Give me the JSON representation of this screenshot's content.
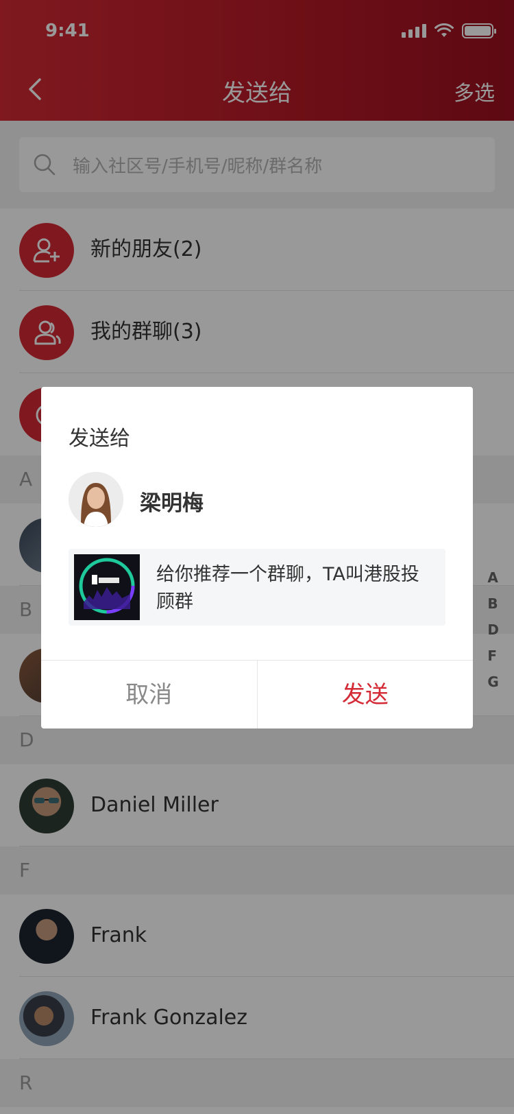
{
  "status": {
    "time": "9:41"
  },
  "header": {
    "title": "发送给",
    "multi_select": "多选"
  },
  "search": {
    "placeholder": "输入社区号/手机号/昵称/群名称"
  },
  "shortcuts": [
    {
      "label": "新的朋友(2)",
      "icon": "add-user-icon"
    },
    {
      "label": "我的群聊(3)",
      "icon": "group-icon"
    }
  ],
  "sections": {
    "a": "A",
    "b": "B",
    "d": "D",
    "f": "F",
    "r": "R"
  },
  "contacts": {
    "daniel": "Daniel Miller",
    "frank": "Frank",
    "frank_g": "Frank Gonzalez"
  },
  "index": [
    "A",
    "B",
    "D",
    "F",
    "G"
  ],
  "dialog": {
    "title": "发送给",
    "recipient": "梁明梅",
    "message": "给你推荐一个群聊，TA叫港股投顾群",
    "cancel": "取消",
    "send": "发送"
  },
  "colors": {
    "accent": "#d42a35",
    "overlay": "rgba(0,0,0,0.4)"
  }
}
